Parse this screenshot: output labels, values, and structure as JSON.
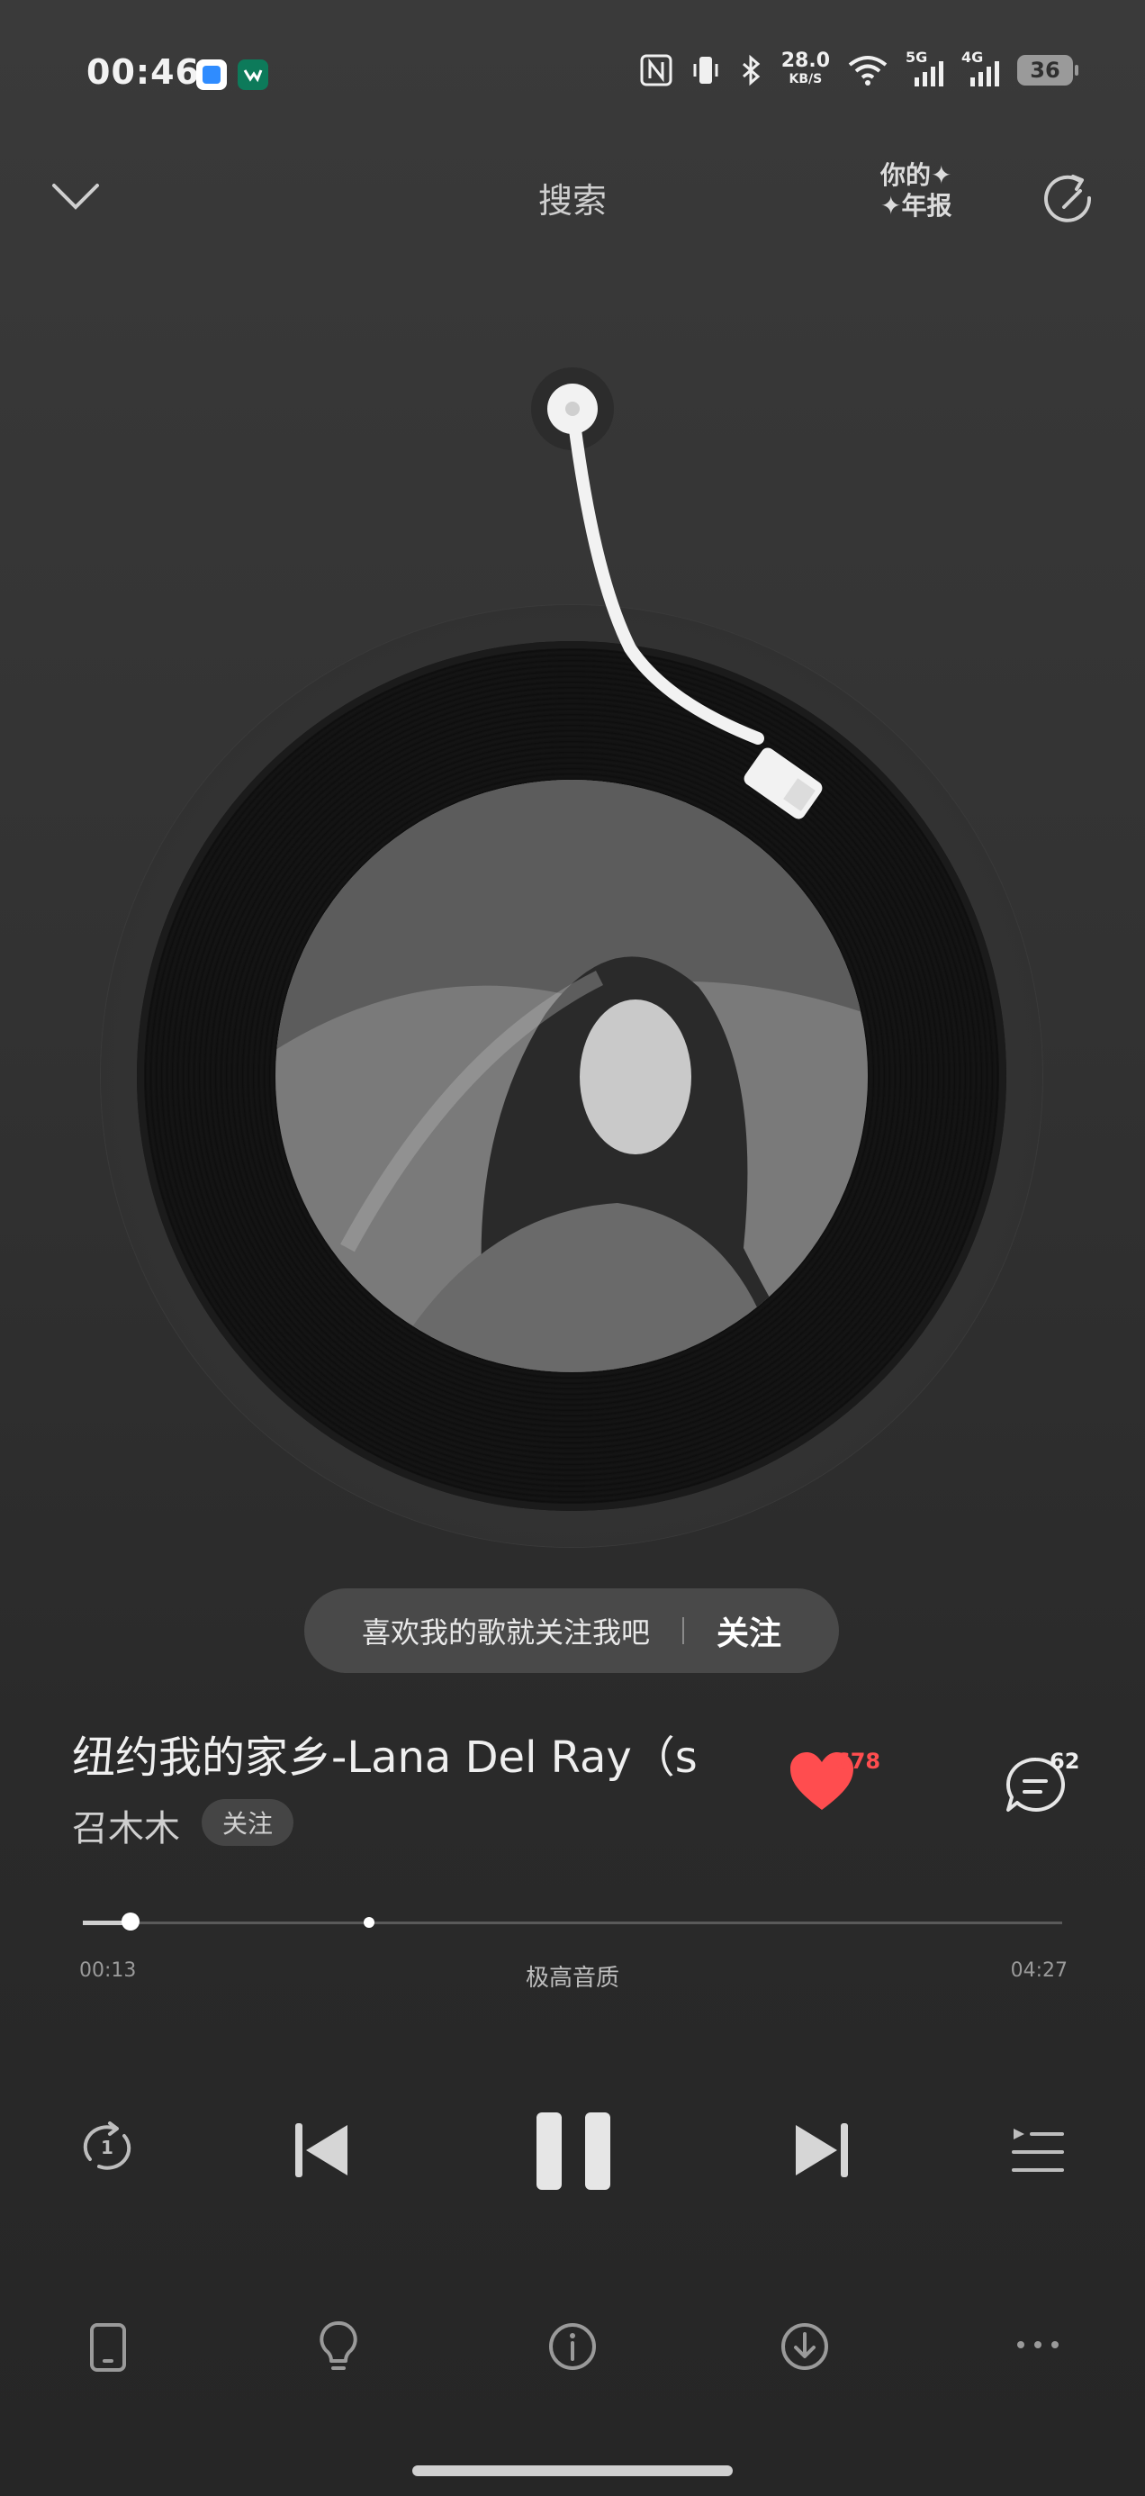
{
  "status_bar": {
    "time": "00:46",
    "net_speed_value": "28.0",
    "net_speed_unit": "KB/S",
    "signal_1_label": "5G",
    "signal_2_label": "4G",
    "battery": "36"
  },
  "header": {
    "title": "搜索",
    "yearly_line1": "你的✦",
    "yearly_line2": "✦年报"
  },
  "popup": {
    "message": "喜欢我的歌就关注我吧",
    "follow": "关注"
  },
  "song": {
    "title": "纽约我的家乡-Lana Del Ray（s",
    "artist": "召木木",
    "artist_follow": "关注",
    "likes": "678",
    "comments": "62"
  },
  "progress": {
    "current": "00:13",
    "total": "04:27",
    "quality": "极高音质",
    "fraction": 0.049
  },
  "colors": {
    "like": "#ff4d4f",
    "background": "#333333"
  }
}
